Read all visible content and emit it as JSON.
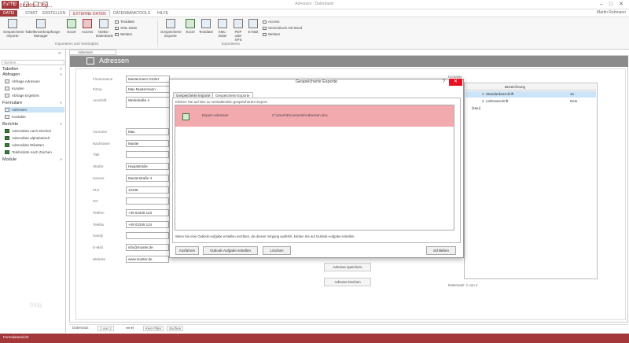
{
  "titlebar": {
    "app": "DATEI",
    "title": "Adressen : Datenbank"
  },
  "ribbon_tabs": [
    "DATEI",
    "START",
    "ERSTELLEN",
    "EXTERNE DATEN",
    "DATENBANKTOOLS",
    "HILFE"
  ],
  "account": "Martin Rohmann",
  "ribbon": {
    "import_buttons": [
      "Gespeicherte Importe",
      "Tabellenverknüpfungs-Manager",
      "Excel",
      "Access",
      "ODBC-Datenbank"
    ],
    "import_small": [
      "Textdatei",
      "XML-Datei",
      "Weitere"
    ],
    "export_buttons": [
      "Gespeicherte Exporte",
      "Excel",
      "Textdatei",
      "XML-Datei",
      "PDF oder XPS",
      "E-Mail"
    ],
    "export_small": [
      "Access",
      "Seriendruck mit Word",
      "Weitere"
    ],
    "group_import": "Importieren und Verknüpfen",
    "group_export": "Exportieren"
  },
  "nav": {
    "title": "Alle Access-Obj...",
    "search": "Suchen...",
    "categories": [
      "Tabellen",
      "Abfragen",
      "Formulare",
      "Berichte",
      "Module"
    ],
    "queries": [
      "Abfrage Adressen",
      "Kunden",
      "Abfrage Ergebnis"
    ],
    "forms": [
      "Adressen",
      "Kontakte"
    ],
    "reports": [
      "Adressliste nach Zeichen",
      "Adressliste alphabetisch",
      "Adressliste Etiketten",
      "Telefonliste nach Zeichen"
    ],
    "watermark": "blog"
  },
  "doc_tab": "Adressen",
  "form": {
    "title": "Adressen",
    "labels": [
      "Firmenname",
      "Firma",
      "Anschrift",
      "Vorname",
      "Nachname",
      "Titel",
      "Straße",
      "Hausnr.",
      "PLZ",
      "Ort",
      "Telefon",
      "Telefax",
      "Handy",
      "E-Mail",
      "Website"
    ],
    "values": [
      "Mustermann GmbH",
      "Max Mustermann",
      "Werkstraße 4",
      "Max",
      "Muster",
      "",
      "Hauptstraße",
      "Musterstraße 4",
      "12345",
      "",
      "+49 02345 123",
      "+49 02345 124",
      "",
      "info@muster.de",
      "www.muster.de"
    ],
    "sub_label": "Kontakte",
    "sub_header": "Bezeichnung",
    "sub_rows": [
      {
        "id": "1",
        "name": "Standardanschrift",
        "flag": "Ja"
      },
      {
        "id": "2",
        "name": "Lieferanschrift",
        "flag": "Nein"
      },
      {
        "id": "",
        "name": "(Neu)",
        "flag": ""
      }
    ],
    "sub_nav": "Datensatz: 1 von 2",
    "buttons": [
      "Adresse speichern",
      "Adresse löschen"
    ]
  },
  "modal": {
    "title": "Gespeicherte Exporte",
    "tabs": [
      "Gespeicherte Importe",
      "Gespeicherte Exporte"
    ],
    "hint": "Klicken Sie auf den zu verwaltenden gespeicherten Export.",
    "row_name": "Export-Adressen",
    "row_path": "C:\\Users\\Documents\\Adressen.xlsx",
    "note": "Wenn Sie eine Outlook-Aufgabe erstellen möchten, die diesen Vorgang ausführt, klicken Sie auf Outlook-Aufgabe erstellen.",
    "buttons": [
      "Ausführen",
      "Outlook-Aufgabe erstellen",
      "Löschen",
      "Schließen"
    ],
    "help": "?",
    "close": "✕"
  },
  "recnav": {
    "label": "Datensatz:",
    "position": "1 von 2",
    "filter": "Kein Filter",
    "search": "Suchen"
  },
  "status": "Formularansicht",
  "colors": {
    "accent": "#a4373a",
    "selected_row": "#f3aaae"
  }
}
